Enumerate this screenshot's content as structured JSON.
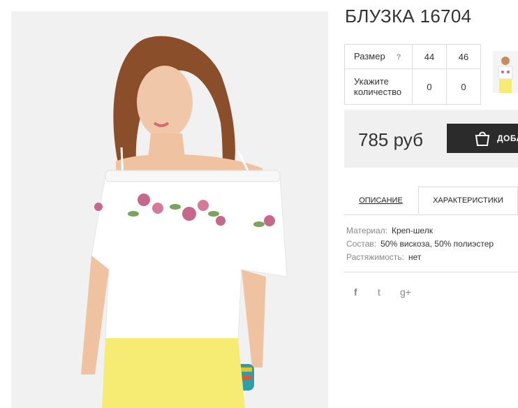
{
  "product": {
    "title": "БЛУЗКА 16704",
    "price": "785 руб"
  },
  "size_table": {
    "size_label": "Размер",
    "help_mark": "?",
    "sizes": [
      "44",
      "46"
    ],
    "qty_label": "Укажите количество",
    "quantities": [
      "0",
      "0"
    ]
  },
  "cart": {
    "label": "ДОБАВИТЬ В КОРЗИНУ"
  },
  "tabs": {
    "description": "ОПИСАНИЕ",
    "characteristics": "ХАРАКТЕРИСТИКИ",
    "active": "characteristics"
  },
  "specs": [
    {
      "key": "Материал:",
      "value": "Креп-шелк"
    },
    {
      "key": "Состав:",
      "value": "50% вискоза, 50% полиэстер"
    },
    {
      "key": "Растяжимость:",
      "value": "нет"
    }
  ],
  "social": {
    "facebook": "f",
    "twitter": "t",
    "googleplus": "g+"
  },
  "icons": [
    "shopping-bag-icon",
    "facebook-icon",
    "twitter-icon",
    "google-plus-icon",
    "question-icon"
  ],
  "colors": {
    "button_bg": "#2b2b2b",
    "price_box_bg": "#f0f0f0",
    "border": "#dcdcdc",
    "photo_bg": "#f1f1f1"
  }
}
